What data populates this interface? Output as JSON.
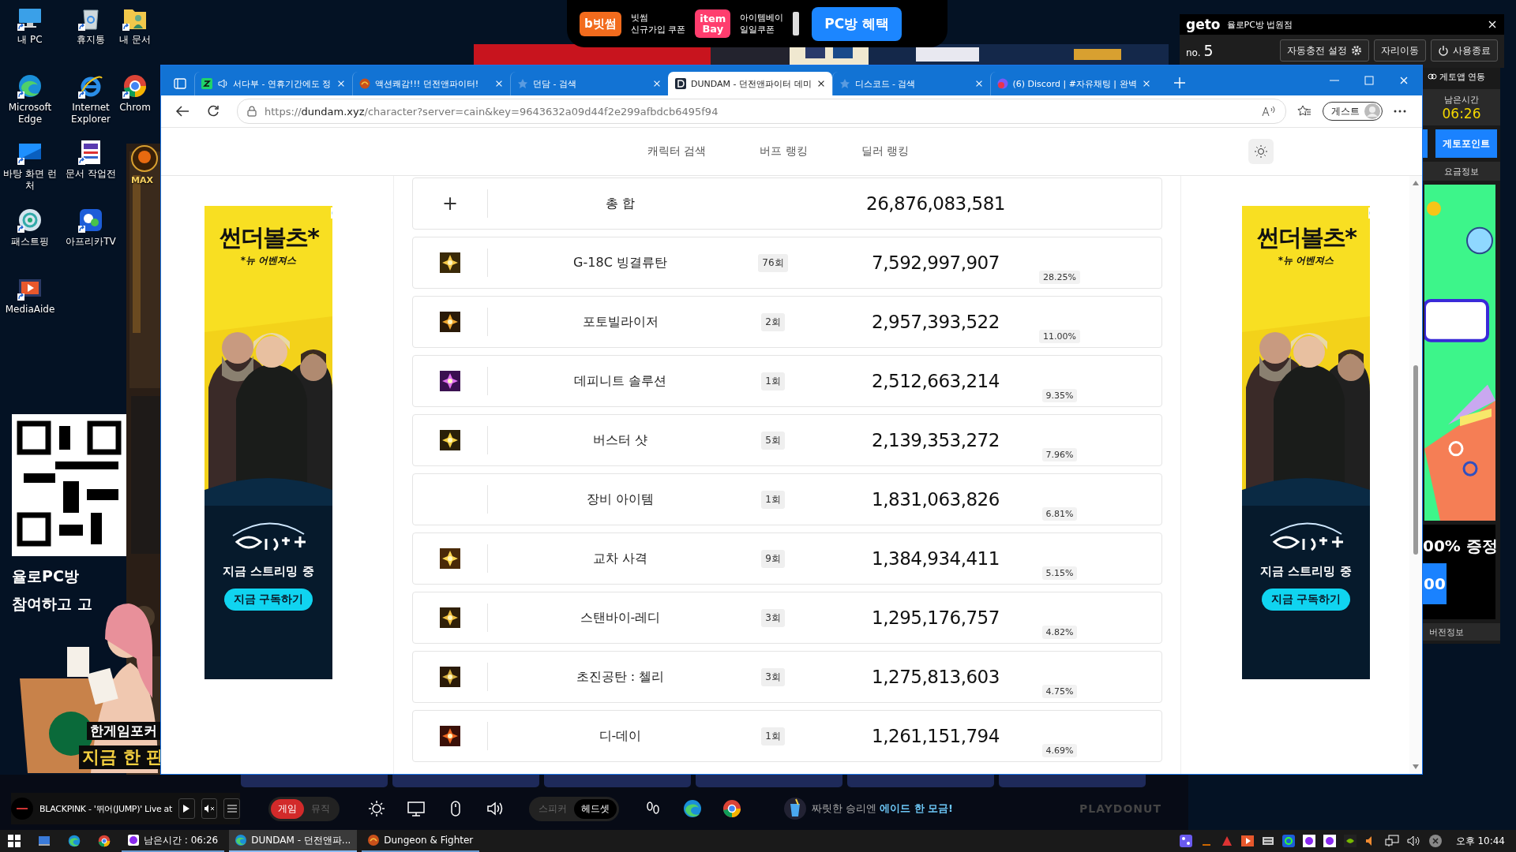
{
  "desktop_icons": [
    {
      "label": "내 PC"
    },
    {
      "label": "휴지통"
    },
    {
      "label": "내 문서"
    },
    {
      "label": "Microsoft Edge"
    },
    {
      "label": "Internet Explorer"
    },
    {
      "label": "Chrom"
    },
    {
      "label": "바탕 화면 런처"
    },
    {
      "label": "문서 작업전"
    },
    {
      "label": "패스트핑"
    },
    {
      "label": "아프리카TV"
    },
    {
      "label": "MediaAide"
    }
  ],
  "game_shortcut": {
    "label": "MAX"
  },
  "left_ads": {
    "caption": [
      "율로PC방",
      "참여하고 고"
    ],
    "poker": [
      "한게임포커",
      "지금 한 판"
    ]
  },
  "promo_bar": {
    "coupons": [
      {
        "logo": "b빗썸",
        "lines": [
          "빗썸",
          "신규가입 쿠폰"
        ]
      },
      {
        "logo": "item Bay",
        "lines": [
          "아이템베이",
          "일일쿠폰"
        ]
      }
    ],
    "button": "PC방 혜택"
  },
  "geto": {
    "brand": "geto",
    "store": "율로PC방 법원점",
    "seat_label": "no.",
    "seat": "5",
    "buttons": [
      "자동충전 설정",
      "자리이동",
      "사용종료"
    ],
    "app_link": "게토앱 연동",
    "time_label": "남은시간",
    "time": "06:26",
    "point_button": "게토포인트",
    "fee_info": "요금정보",
    "ad_text": "00% 증정",
    "ad_button": "00",
    "version": "버전정보"
  },
  "browser": {
    "tabs": [
      {
        "title": "서다부 - 연휴기간에도 정",
        "selected": false,
        "audio": true
      },
      {
        "title": "액션쾌감!!! 던전앤파이터!",
        "selected": false,
        "audio": false
      },
      {
        "title": "던담 - 검색",
        "selected": false,
        "audio": false
      },
      {
        "title": "DUNDAM - 던전앤파이터 데미",
        "selected": true,
        "audio": false
      },
      {
        "title": "디스코드 - 검색",
        "selected": false,
        "audio": false
      },
      {
        "title": "(6) Discord | #자유채팅 | 완벽",
        "selected": false,
        "audio": false
      }
    ],
    "url": "https://**dundam.xyz**/character?server=cain&key=9643632a09d44f2e299afbdcb6495f94",
    "profile": "게스트"
  },
  "page": {
    "nav": [
      "캐릭터 검색",
      "버프 랭킹",
      "딜러 랭킹"
    ],
    "total": {
      "expand": "+",
      "label": "총 합",
      "damage": "26,876,083,581"
    },
    "skills": [
      {
        "kind": "skill",
        "name": "G-18C 빙결류탄",
        "count": "76회",
        "damage": "7,592,997,907",
        "share": "28.25%"
      },
      {
        "kind": "skill",
        "name": "포토빌라이저",
        "count": "2회",
        "damage": "2,957,393,522",
        "share": "11.00%"
      },
      {
        "kind": "skill",
        "name": "데피니트 솔루션",
        "count": "1회",
        "damage": "2,512,663,214",
        "share": "9.35%"
      },
      {
        "kind": "skill",
        "name": "버스터 샷",
        "count": "5회",
        "damage": "2,139,353,272",
        "share": "7.96%"
      },
      {
        "kind": "equipment",
        "name": "장비 아이템",
        "count": "1회",
        "damage": "1,831,063,826",
        "share": "6.81%"
      },
      {
        "kind": "skill",
        "name": "교차 사격",
        "count": "9회",
        "damage": "1,384,934,411",
        "share": "5.15%"
      },
      {
        "kind": "skill",
        "name": "스탠바이-레디",
        "count": "3회",
        "damage": "1,295,176,757",
        "share": "4.82%"
      },
      {
        "kind": "skill",
        "name": "초진공탄 : 첼리",
        "count": "3회",
        "damage": "1,275,813,603",
        "share": "4.75%"
      },
      {
        "kind": "skill",
        "name": "디-데이",
        "count": "1회",
        "damage": "1,261,151,794",
        "share": "4.69%"
      }
    ],
    "ads": [
      {
        "title": "썬더볼츠*",
        "subtitle": "*뉴 어벤져스",
        "tagline": "지금 스트리밍 중",
        "button": "지금 구독하기"
      },
      {
        "title": "썬더볼츠*",
        "subtitle": "*뉴 어벤져스",
        "tagline": "지금 스트리밍 중",
        "button": "지금 구독하기"
      }
    ]
  },
  "bottom_bar": {
    "track": "BLACKPINK - '뛰어(JUMP)' Live at",
    "mode_toggle": [
      {
        "label": "게임",
        "selected": true
      },
      {
        "label": "뮤직",
        "selected": false
      }
    ],
    "audio_toggle": [
      {
        "label": "스피커",
        "selected": false
      },
      {
        "label": "헤드셋",
        "selected": true
      }
    ],
    "slogan": "짜릿한 승리엔 **에이드 한 모금!**",
    "brand": "PLAYDONUT"
  },
  "taskbar": {
    "items": [
      {
        "label": "남은시간 : 06:26",
        "selected": false
      },
      {
        "label": "DUNDAM - 던전앤파...",
        "selected": true
      },
      {
        "label": "Dungeon & Fighter",
        "selected": false
      }
    ],
    "clock": "오후 10:44"
  }
}
